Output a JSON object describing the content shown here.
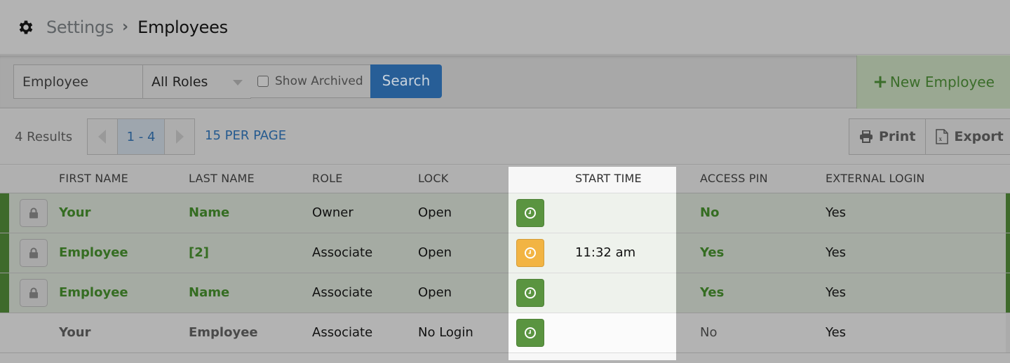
{
  "breadcrumb": {
    "icon": "gear-icon",
    "parent": "Settings",
    "separator": "›",
    "current": "Employees"
  },
  "filters": {
    "name_input": {
      "value": "Employee",
      "placeholder": "Employee"
    },
    "role_select": {
      "selected": "All Roles"
    },
    "show_archived": {
      "label": "Show Archived",
      "checked": false
    },
    "search_button": "Search",
    "new_employee_button": {
      "icon": "plus-icon",
      "label": "New Employee"
    }
  },
  "results": {
    "count_label": "4 Results",
    "pagination": {
      "range": "1 - 4",
      "prev_icon": "triangle-left-icon",
      "next_icon": "triangle-right-icon"
    },
    "per_page": "15 PER PAGE",
    "print_button": {
      "icon": "printer-icon",
      "label": "Print"
    },
    "export_button": {
      "icon": "excel-file-icon",
      "label": "Export"
    }
  },
  "table": {
    "columns": [
      "FIRST NAME",
      "LAST NAME",
      "ROLE",
      "LOCK",
      "START TIME",
      "ACCESS PIN",
      "EXTERNAL LOGIN"
    ],
    "rows": [
      {
        "first": "Your",
        "last": "Name",
        "role": "Owner",
        "lock": "Open",
        "clock_status": "green",
        "start_time": "",
        "access_pin": "No",
        "external_login": "Yes",
        "active": true
      },
      {
        "first": "Employee",
        "last": "[2]",
        "role": "Associate",
        "lock": "Open",
        "clock_status": "orange",
        "start_time": "11:32 am",
        "access_pin": "Yes",
        "external_login": "Yes",
        "active": true
      },
      {
        "first": "Employee",
        "last": "Name",
        "role": "Associate",
        "lock": "Open",
        "clock_status": "green",
        "start_time": "",
        "access_pin": "Yes",
        "external_login": "Yes",
        "active": true
      },
      {
        "first": "Your",
        "last": "Employee",
        "role": "Associate",
        "lock": "No Login",
        "clock_status": "green",
        "start_time": "",
        "access_pin": "No",
        "external_login": "Yes",
        "active": false
      }
    ]
  },
  "colors": {
    "brand_green": "#3e6a2b",
    "clock_green": "#5a9440",
    "clock_orange": "#f2b443",
    "search_blue": "#275e97",
    "link_blue": "#255a8f"
  }
}
